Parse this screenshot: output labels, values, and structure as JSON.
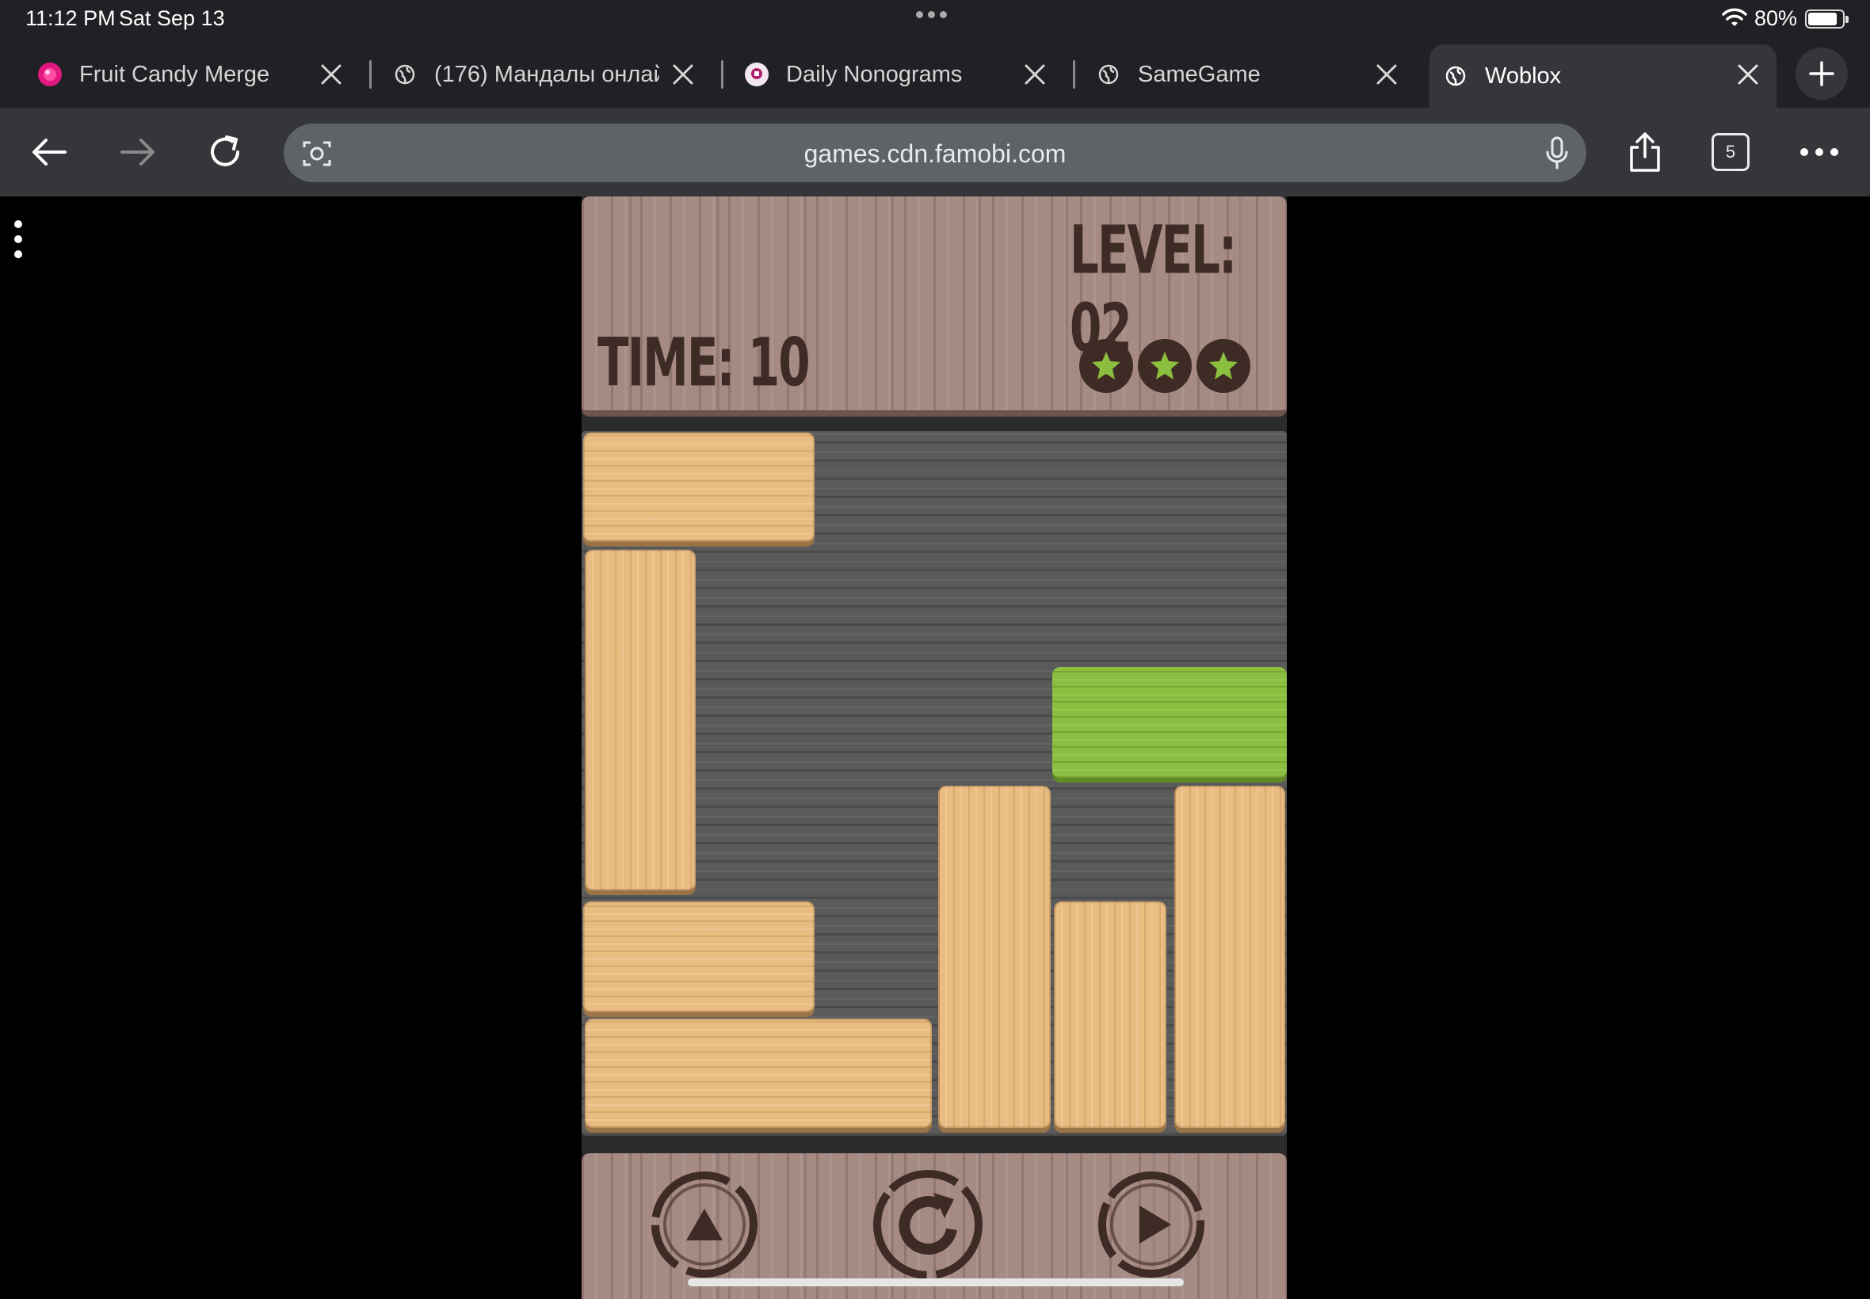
{
  "status_bar": {
    "time": "11:12 PM",
    "date": "Sat Sep 13",
    "battery": "80%"
  },
  "tabs": [
    {
      "title": "Fruit Candy Merge",
      "favicon": "candy-icon",
      "active": false
    },
    {
      "title": "(176) Мандалы онлай",
      "favicon": "globe-icon",
      "active": false
    },
    {
      "title": "Daily Nonograms",
      "favicon": "nonogram-icon",
      "active": false
    },
    {
      "title": "SameGame",
      "favicon": "globe-icon",
      "active": false
    },
    {
      "title": "Woblox",
      "favicon": "globe-icon",
      "active": true
    }
  ],
  "toolbar": {
    "url": "games.cdn.famobi.com",
    "tab_count": "5"
  },
  "game": {
    "level_label": "LEVEL: 02",
    "time_label": "TIME: 10",
    "stars_earned": 3,
    "stars_total": 3,
    "colors": {
      "wood_panel": "#a58b84",
      "board": "#5a5a5a",
      "block": "#e9bd82",
      "target_block": "#8cbe3f",
      "ink": "#3e2b25"
    },
    "controls": [
      "prev-level-button",
      "restart-button",
      "next-level-button"
    ]
  }
}
